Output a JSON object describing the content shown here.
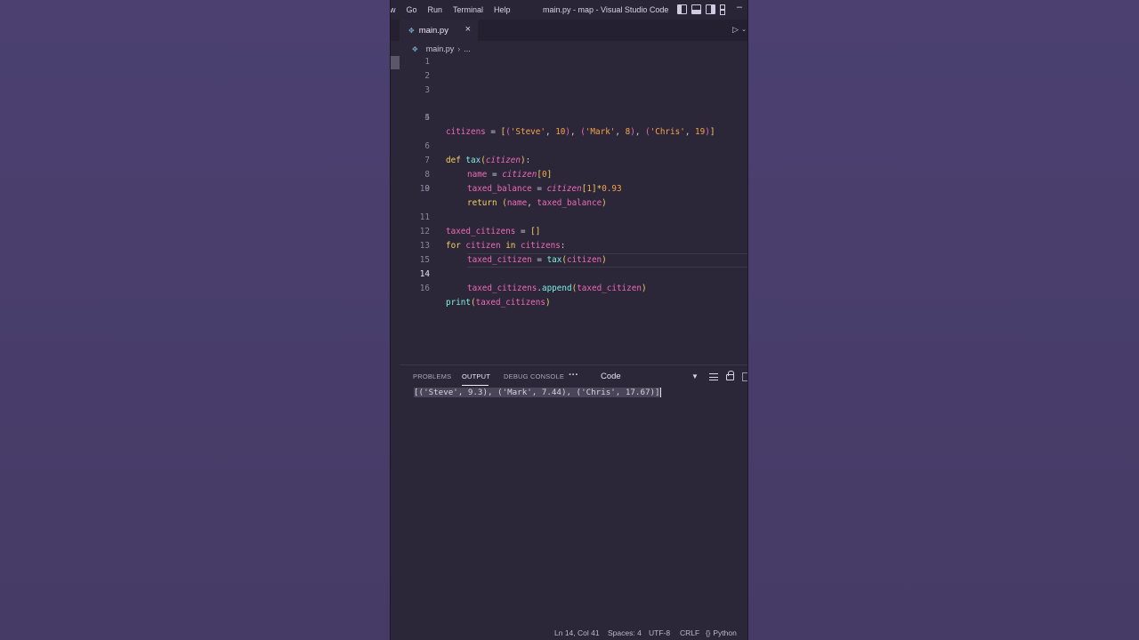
{
  "menu": [
    "w",
    "Go",
    "Run",
    "Terminal",
    "Help"
  ],
  "window_title": "main.py - map - Visual Studio Code",
  "tab": {
    "label": "main.py",
    "close": "×"
  },
  "breadcrumb": {
    "file": "main.py",
    "sep": "›",
    "rest": "..."
  },
  "editor": {
    "active_line": 14,
    "line_numbers": [
      "1",
      "2",
      "3",
      "4",
      "5",
      "6",
      "7",
      "8",
      "9",
      "10",
      "11",
      "12",
      "13",
      "14",
      "15",
      "16"
    ],
    "code_lines": [
      "",
      "",
      "",
      "citizens = [('Steve', 10), ('Mark', 8), ('Chris', 19)]",
      "",
      "def tax(citizen):",
      "    name = citizen[0]",
      "    taxed_balance = citizen[1]*0.93",
      "    return (name, taxed_balance)",
      "",
      "taxed_citizens = []",
      "for citizen in citizens:",
      "    taxed_citizen = tax(citizen)",
      "    taxed_citizens.append(taxed_citizen)",
      "",
      "print(taxed_citizens)"
    ]
  },
  "panel": {
    "tabs": [
      "PROBLEMS",
      "OUTPUT",
      "DEBUG CONSOLE"
    ],
    "active_tab": "OUTPUT",
    "more": "···",
    "channel": "Code",
    "output": "[('Steve', 9.3), ('Mark', 7.44), ('Chris', 17.67)]"
  },
  "status": {
    "position": "Ln 14, Col 41",
    "spaces": "Spaces: 4",
    "encoding": "UTF-8",
    "eol": "CRLF",
    "language": "Python"
  },
  "icons": {
    "python": "python-file-icon",
    "run": "run-icon",
    "close": "close-icon"
  }
}
